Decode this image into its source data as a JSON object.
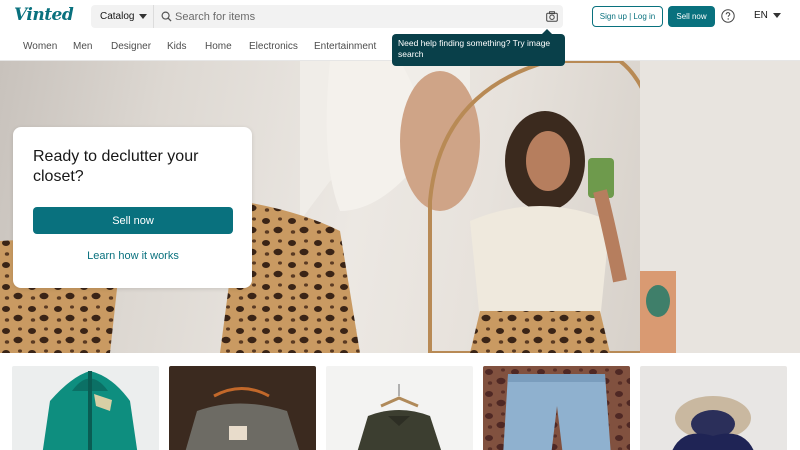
{
  "header": {
    "logo": "Vinted",
    "catalog_label": "Catalog",
    "search_placeholder": "Search for items",
    "signup_label": "Sign up | Log in",
    "sell_label": "Sell now",
    "language": "EN"
  },
  "categories": [
    "Women",
    "Men",
    "Designer",
    "Kids",
    "Home",
    "Electronics",
    "Entertainment"
  ],
  "tooltip": {
    "text": "Need help finding something? Try image search"
  },
  "hero": {
    "title": "Ready to declutter your closet?",
    "sell_label": "Sell now",
    "learn_label": "Learn how it works"
  },
  "products": [
    {
      "name": "green jacket"
    },
    {
      "name": "grey jacket"
    },
    {
      "name": "dark polo shirt"
    },
    {
      "name": "light blue jeans"
    },
    {
      "name": "navy parka"
    }
  ],
  "colors": {
    "brand": "#09717e",
    "tooltip_bg": "#09404a"
  },
  "icons": {
    "search": "search-icon",
    "camera": "camera-icon",
    "help": "help-icon"
  }
}
